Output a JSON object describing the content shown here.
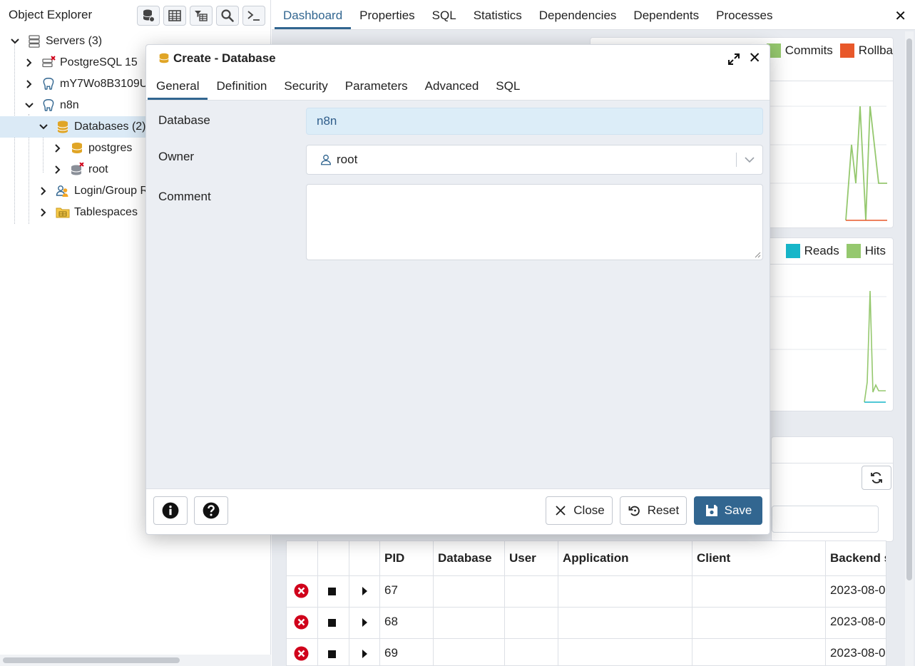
{
  "explorer": {
    "title": "Object Explorer",
    "tree": [
      {
        "label": "Servers (3)"
      },
      {
        "label": "PostgreSQL 15"
      },
      {
        "label": "mY7Wo8B3109U"
      },
      {
        "label": "n8n"
      },
      {
        "label": "Databases (2)"
      },
      {
        "label": "postgres"
      },
      {
        "label": "root"
      },
      {
        "label": "Login/Group R"
      },
      {
        "label": "Tablespaces"
      }
    ]
  },
  "main": {
    "tabs": [
      {
        "label": "Dashboard"
      },
      {
        "label": "Properties"
      },
      {
        "label": "SQL"
      },
      {
        "label": "Statistics"
      },
      {
        "label": "Dependencies"
      },
      {
        "label": "Dependents"
      },
      {
        "label": "Processes"
      }
    ],
    "close_glyph": "✕",
    "legend_tx": [
      {
        "label": "Commits",
        "color": "#95c86e"
      },
      {
        "label": "Rollba",
        "color": "#e8582a"
      }
    ],
    "legend_io": [
      {
        "label": "Reads",
        "color": "#17b6c9"
      },
      {
        "label": "Hits",
        "color": "#95c86e"
      }
    ],
    "sessions": {
      "columns": [
        "PID",
        "Database",
        "User",
        "Application",
        "Client",
        "Backend s"
      ],
      "rows": [
        {
          "pid": "67",
          "backend": "2023-08-0"
        },
        {
          "pid": "68",
          "backend": "2023-08-0"
        },
        {
          "pid": "69",
          "backend": "2023-08-0"
        }
      ]
    }
  },
  "dialog": {
    "title": "Create - Database",
    "tabs": [
      {
        "label": "General"
      },
      {
        "label": "Definition"
      },
      {
        "label": "Security"
      },
      {
        "label": "Parameters"
      },
      {
        "label": "Advanced"
      },
      {
        "label": "SQL"
      }
    ],
    "fields": {
      "database_label": "Database",
      "database_value": "n8n",
      "owner_label": "Owner",
      "owner_value": "root",
      "comment_label": "Comment",
      "comment_value": ""
    },
    "buttons": {
      "close": "Close",
      "reset": "Reset",
      "save": "Save"
    },
    "accent": "#326690"
  }
}
